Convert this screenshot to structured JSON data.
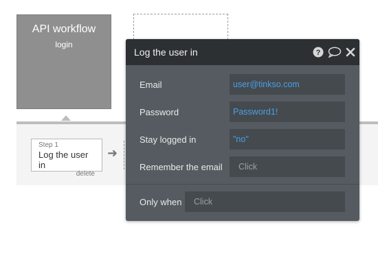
{
  "trigger": {
    "title": "API workflow",
    "subtitle": "login"
  },
  "step": {
    "number_label": "Step 1",
    "name": "Log the user in",
    "delete_label": "delete"
  },
  "panel": {
    "title": "Log the user in",
    "icons": [
      "help-icon",
      "comment-icon",
      "close-icon"
    ],
    "fields": [
      {
        "label": "Email",
        "value": "user@tinkso.com",
        "kind": "expression"
      },
      {
        "label": "Password",
        "value": "Password1!",
        "kind": "expression"
      },
      {
        "label": "Stay logged in",
        "value": "\"no\"",
        "kind": "expression"
      },
      {
        "label": "Remember the email",
        "value": "Click",
        "kind": "placeholder"
      }
    ],
    "only_when": {
      "label": "Only when",
      "value": "Click"
    }
  },
  "colors": {
    "panel_bg": "#555b60",
    "panel_header": "#2c3033",
    "expression_blue": "#4a9fe8",
    "trigger_grey": "#8f8f8f"
  }
}
